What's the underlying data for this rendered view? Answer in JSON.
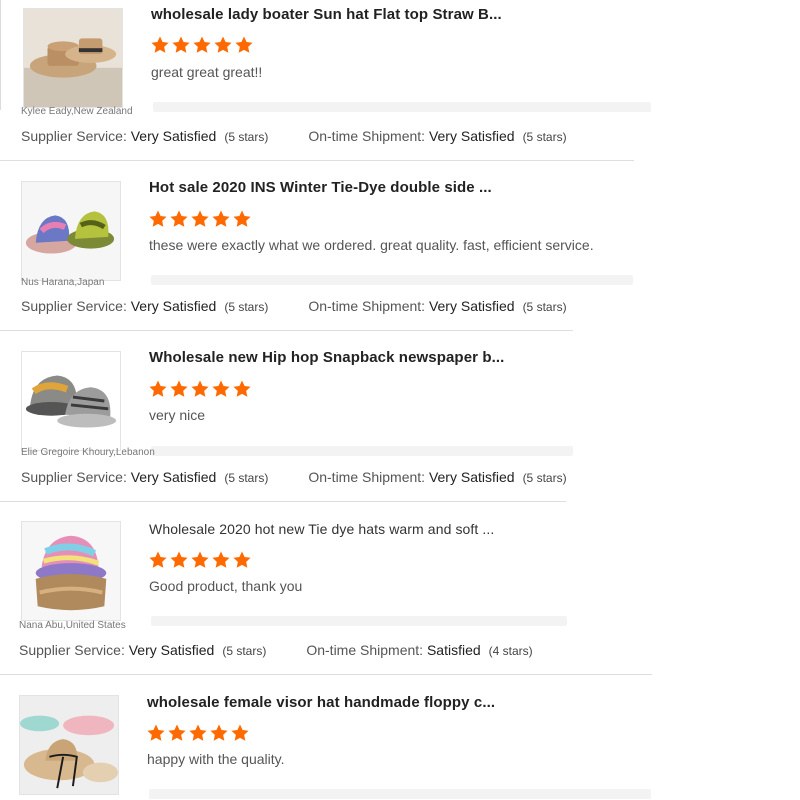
{
  "colors": {
    "star": "#ff6a00",
    "divider": "#dedede"
  },
  "reviews": [
    {
      "title": "wholesale lady boater Sun hat Flat top Straw B...",
      "comment": "great great great!!",
      "buyer": "Kylee Eady,New Zealand",
      "stars": 5,
      "image_icon": "straw-boater-hat-photo",
      "supplier_label": "Supplier Service:",
      "supplier_value": "Very Satisfied",
      "supplier_count": "(5 stars)",
      "shipment_label": "On-time Shipment:",
      "shipment_value": "Very Satisfied",
      "shipment_count": "(5 stars)"
    },
    {
      "title": "Hot sale 2020 INS Winter Tie-Dye double side ...",
      "comment": "these were exactly what we ordered. great quality. fast, efficient service.",
      "buyer": "Nus Harana,Japan",
      "stars": 5,
      "image_icon": "tie-dye-bucket-hat-photo",
      "supplier_label": "Supplier Service:",
      "supplier_value": "Very Satisfied",
      "supplier_count": "(5 stars)",
      "shipment_label": "On-time Shipment:",
      "shipment_value": "Very Satisfied",
      "shipment_count": "(5 stars)"
    },
    {
      "title": "Wholesale new Hip hop Snapback newspaper b...",
      "comment": "very nice",
      "buyer": "Elie Gregoire Khoury,Lebanon",
      "stars": 5,
      "image_icon": "snapback-cap-photo",
      "supplier_label": "Supplier Service:",
      "supplier_value": "Very Satisfied",
      "supplier_count": "(5 stars)",
      "shipment_label": "On-time Shipment:",
      "shipment_value": "Very Satisfied",
      "shipment_count": "(5 stars)"
    },
    {
      "title": "Wholesale 2020 hot new Tie dye hats warm and soft ...",
      "comment": "Good product, thank you",
      "buyer": "Nana Abu,United States",
      "stars": 5,
      "image_icon": "fuzzy-tie-dye-hat-photo",
      "supplier_label": "Supplier Service:",
      "supplier_value": "Very Satisfied",
      "supplier_count": "(5 stars)",
      "shipment_label": "On-time Shipment:",
      "shipment_value": "Satisfied",
      "shipment_count": "(4 stars)"
    },
    {
      "title": "wholesale female visor hat handmade floppy c...",
      "comment": "happy with the quality.",
      "stars": 5,
      "image_icon": "floppy-visor-hat-photo"
    }
  ]
}
